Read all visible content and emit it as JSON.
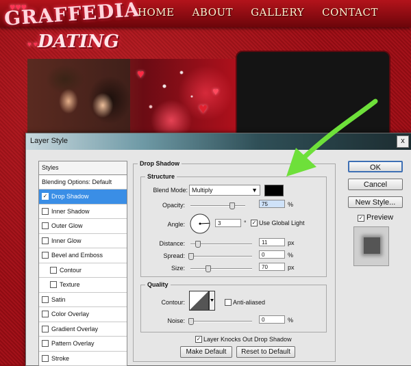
{
  "site": {
    "logo_line1": "GRAFFEDIA",
    "logo_line2": "DATING",
    "nav": [
      "HOME",
      "ABOUT",
      "GALLERY",
      "CONTACT"
    ]
  },
  "dialog": {
    "title": "Layer Style",
    "close": "x",
    "styles_header": "Styles",
    "blending": "Blending Options: Default",
    "styles": [
      {
        "label": "Drop Shadow",
        "checked": true,
        "selected": true,
        "sub": false
      },
      {
        "label": "Inner Shadow",
        "checked": false,
        "selected": false,
        "sub": false
      },
      {
        "label": "Outer Glow",
        "checked": false,
        "selected": false,
        "sub": false
      },
      {
        "label": "Inner Glow",
        "checked": false,
        "selected": false,
        "sub": false
      },
      {
        "label": "Bevel and Emboss",
        "checked": false,
        "selected": false,
        "sub": false
      },
      {
        "label": "Contour",
        "checked": false,
        "selected": false,
        "sub": true
      },
      {
        "label": "Texture",
        "checked": false,
        "selected": false,
        "sub": true
      },
      {
        "label": "Satin",
        "checked": false,
        "selected": false,
        "sub": false
      },
      {
        "label": "Color Overlay",
        "checked": false,
        "selected": false,
        "sub": false
      },
      {
        "label": "Gradient Overlay",
        "checked": false,
        "selected": false,
        "sub": false
      },
      {
        "label": "Pattern Overlay",
        "checked": false,
        "selected": false,
        "sub": false
      },
      {
        "label": "Stroke",
        "checked": false,
        "selected": false,
        "sub": false
      }
    ],
    "drop_shadow": {
      "section_title": "Drop Shadow",
      "structure_title": "Structure",
      "blend_mode_label": "Blend Mode:",
      "blend_mode_value": "Multiply",
      "shadow_color": "#000000",
      "opacity_label": "Opacity:",
      "opacity_value": "75",
      "angle_label": "Angle:",
      "angle_value": "3",
      "angle_unit": "°",
      "use_global_light": "Use Global Light",
      "distance_label": "Distance:",
      "distance_value": "11",
      "spread_label": "Spread:",
      "spread_value": "0",
      "size_label": "Size:",
      "size_value": "70",
      "unit_px": "px",
      "unit_pct": "%",
      "quality_title": "Quality",
      "contour_label": "Contour:",
      "anti_aliased": "Anti-aliased",
      "noise_label": "Noise:",
      "noise_value": "0",
      "knocks_out": "Layer Knocks Out Drop Shadow",
      "make_default": "Make Default",
      "reset_default": "Reset to Default"
    },
    "buttons": {
      "ok": "OK",
      "cancel": "Cancel",
      "new_style": "New Style...",
      "preview": "Preview"
    },
    "slider_levels": {
      "opacity": 0.75,
      "distance": 0.11,
      "spread": 0.0,
      "size": 0.28,
      "noise": 0.0
    }
  },
  "colors": {
    "accent_selected": "#3a8ee6",
    "arrow": "#6ee03a",
    "site_red": "#a3121a"
  }
}
